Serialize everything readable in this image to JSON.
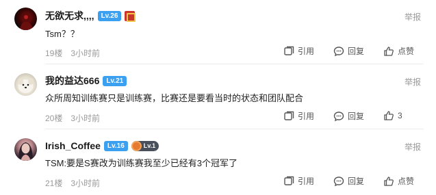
{
  "comments": [
    {
      "username": "无欲无求,,,,",
      "level": "Lv.26",
      "content": "Tsm？？",
      "floor": "19楼",
      "time": "3小时前",
      "report": "举报",
      "quote_label": "引用",
      "reply_label": "回复",
      "like_label": "点赞",
      "extra_badge": "red-medal-icon"
    },
    {
      "username": "我的益达666",
      "level": "Lv.21",
      "content": "众所周知训练赛只是训练赛，比赛还是要看当时的状态和团队配合",
      "floor": "20楼",
      "time": "3小时前",
      "report": "举报",
      "quote_label": "引用",
      "reply_label": "回复",
      "like_label": "3"
    },
    {
      "username": "Irish_Coffee",
      "level": "Lv.16",
      "club_level": "Lv.1",
      "content": "TSM:要是S赛改为训练赛我至少已经有3个冠军了",
      "floor": "21楼",
      "time": "3小时前",
      "report": "举报",
      "quote_label": "引用",
      "reply_label": "回复",
      "like_label": "点赞"
    }
  ],
  "colors": {
    "level_badge": "#3ca0f0",
    "muted_text": "#9a9a9a",
    "action_text": "#555555"
  }
}
